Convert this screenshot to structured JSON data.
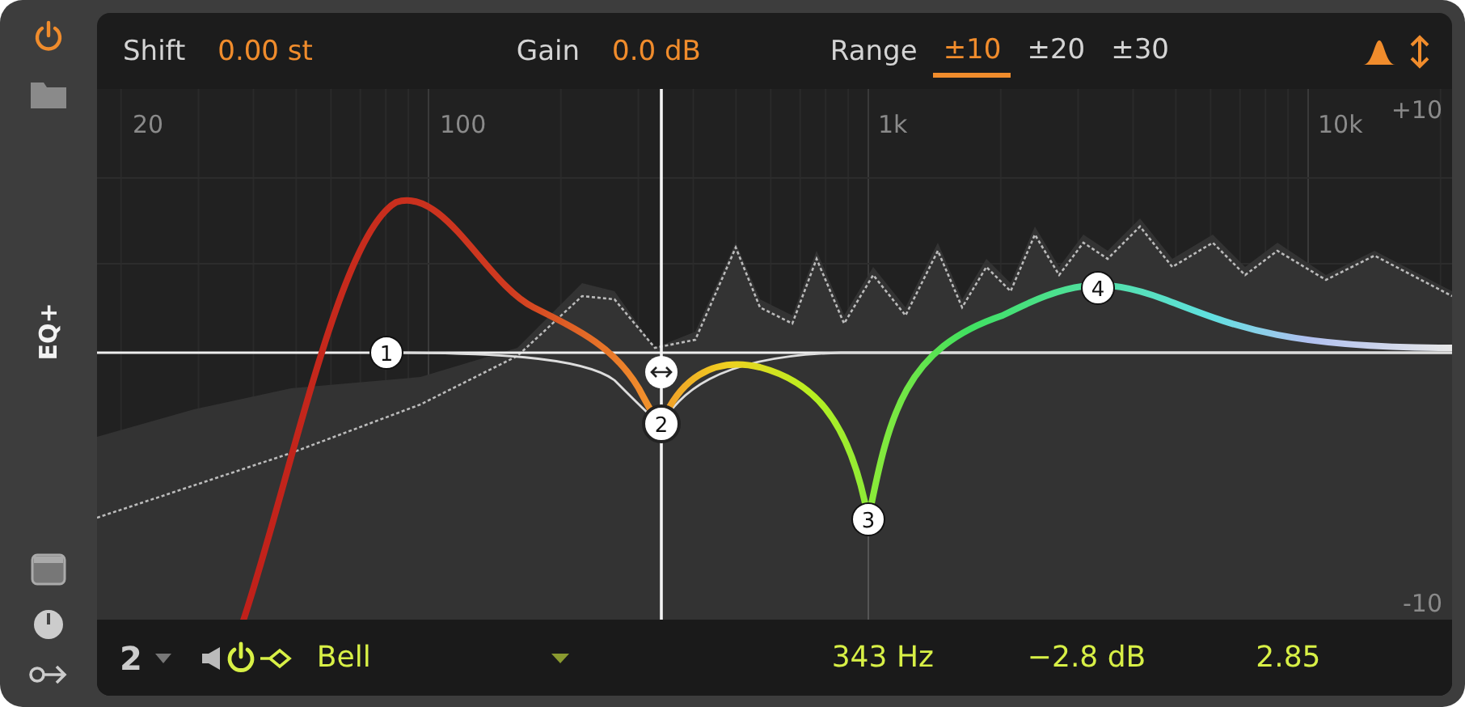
{
  "device": {
    "name": "EQ+",
    "enabled": true
  },
  "header": {
    "shift": {
      "label": "Shift",
      "value": "0.00 st"
    },
    "gain": {
      "label": "Gain",
      "value": "0.0 dB"
    },
    "range": {
      "label": "Range",
      "options": [
        {
          "label": "±10",
          "selected": true
        },
        {
          "label": "±20",
          "selected": false
        },
        {
          "label": "±30",
          "selected": false
        }
      ]
    }
  },
  "graph": {
    "freq_labels": [
      "20",
      "100",
      "1k",
      "10k"
    ],
    "db_labels": [
      "+10",
      "-10"
    ],
    "bands": [
      {
        "number": "1",
        "selected": false
      },
      {
        "number": "2",
        "selected": true
      },
      {
        "number": "3",
        "selected": false
      },
      {
        "number": "4",
        "selected": false
      }
    ]
  },
  "band_bar": {
    "band": "2",
    "enabled": true,
    "type": "Bell",
    "frequency": "343 Hz",
    "gain": "−2.8 dB",
    "q": "2.85"
  }
}
